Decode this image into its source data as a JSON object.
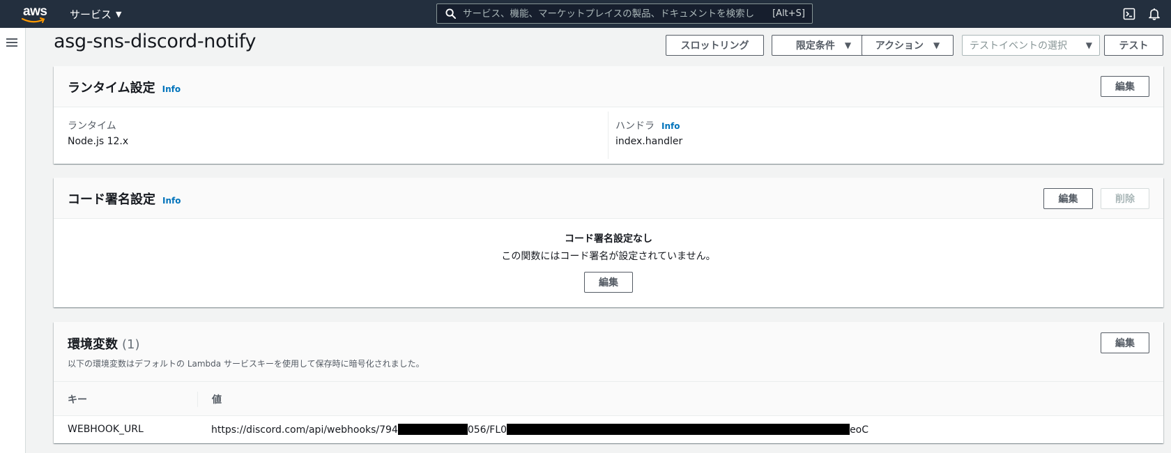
{
  "nav": {
    "logo": "aws",
    "services_label": "サービス",
    "search_placeholder": "サービス、機能、マーケットプレイスの製品、ドキュメントを検索し",
    "search_shortcut": "[Alt+S]"
  },
  "header": {
    "title": "asg-sns-discord-notify",
    "throttle_label": "スロットリング",
    "qualifiers_label": "限定条件",
    "actions_label": "アクション",
    "test_event_placeholder": "テストイベントの選択",
    "test_label": "テスト"
  },
  "runtime_panel": {
    "title": "ランタイム設定",
    "info": "Info",
    "edit_label": "編集",
    "runtime_label": "ランタイム",
    "runtime_value": "Node.js 12.x",
    "handler_label": "ハンドラ",
    "handler_info": "Info",
    "handler_value": "index.handler"
  },
  "code_signing_panel": {
    "title": "コード署名設定",
    "info": "Info",
    "edit_label": "編集",
    "delete_label": "削除",
    "empty_title": "コード署名設定なし",
    "empty_desc": "この関数にはコード署名が設定されていません。",
    "empty_edit_label": "編集"
  },
  "env_panel": {
    "title": "環境変数",
    "count": "(1)",
    "edit_label": "編集",
    "description": "以下の環境変数はデフォルトの Lambda サービスキーを使用して保存時に暗号化されました。",
    "columns": [
      "キー",
      "値"
    ],
    "rows": [
      {
        "key": "WEBHOOK_URL",
        "value_part1": "https://discord.com/api/webhooks/794",
        "value_part2": "056/FL0",
        "value_part3": "eoC"
      }
    ]
  }
}
